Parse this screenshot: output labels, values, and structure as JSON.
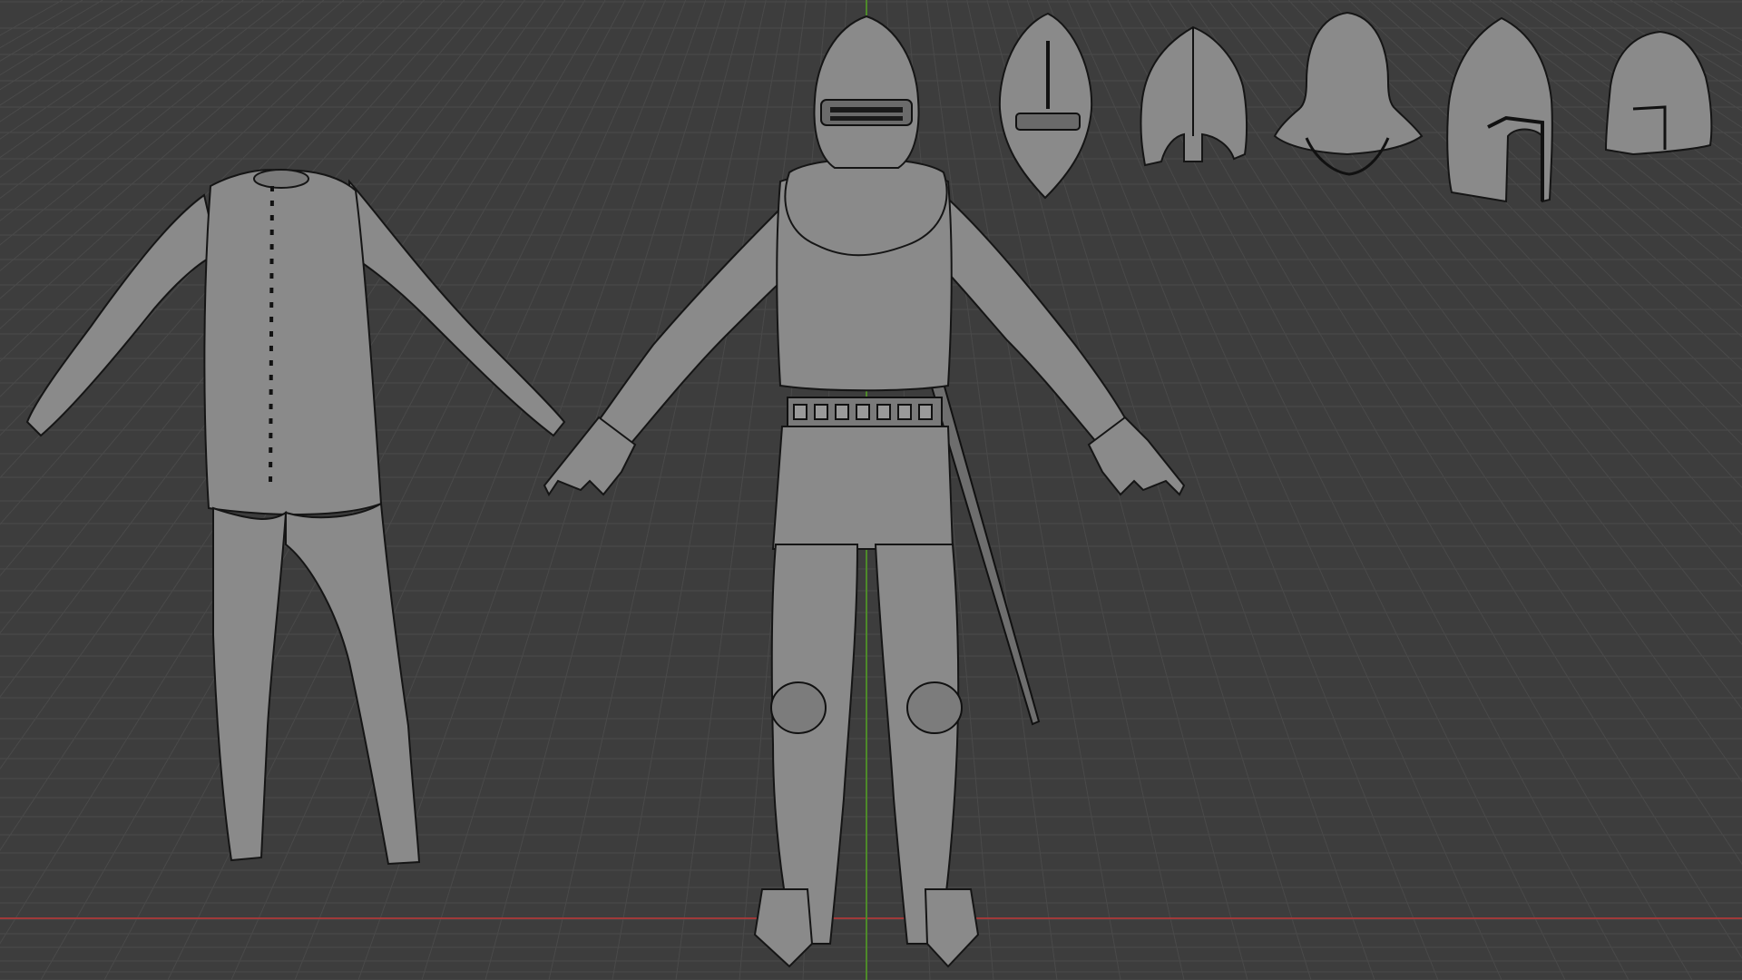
{
  "viewport": {
    "background_color": "#3d3d3d",
    "grid_color": "#4a4a4a",
    "x_axis_color": "#a03a3a",
    "y_axis_color": "#4e8a2a",
    "mesh_fill": "#8a8a8a",
    "wire_color": "#151515"
  },
  "objects": [
    {
      "name": "gambeson-tunic-and-hose"
    },
    {
      "name": "armored-knight"
    },
    {
      "name": "helmet-bascinet-visor"
    },
    {
      "name": "helmet-nasal"
    },
    {
      "name": "helmet-kettle-hat"
    },
    {
      "name": "helmet-barbute"
    },
    {
      "name": "helmet-sallet"
    }
  ]
}
